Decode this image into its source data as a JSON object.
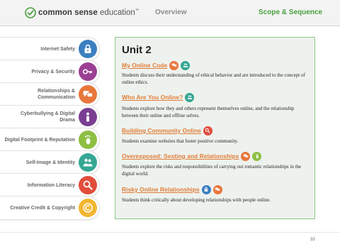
{
  "header": {
    "logo_bold": "common sense",
    "logo_light": "education",
    "logo_mark": "™",
    "nav": {
      "overview": "Overview",
      "scope": "Scope & Sequence"
    },
    "colors": {
      "active": "#4aa03f",
      "inactive": "#8c8c8c"
    }
  },
  "sidebar": {
    "items": [
      {
        "label": "Internet Safety",
        "icon": "lock-icon",
        "color": "#3b7fc0"
      },
      {
        "label": "Privacy & Security",
        "icon": "key-icon",
        "color": "#9b3f93"
      },
      {
        "label": "Relationships & Communication",
        "icon": "chat-bubbles-icon",
        "color": "#e8773c"
      },
      {
        "label": "Cyberbullying & Digital Drama",
        "icon": "person-icon",
        "color": "#7a3f92"
      },
      {
        "label": "Digital Footprint & Reputation",
        "icon": "footprint-icon",
        "color": "#8dbf42"
      },
      {
        "label": "Self-Image & Identity",
        "icon": "people-icon",
        "color": "#35a794"
      },
      {
        "label": "Information Literacy",
        "icon": "magnifier-icon",
        "color": "#e24d3b"
      },
      {
        "label": "Creative Credit & Copyright",
        "icon": "copyright-icon",
        "color": "#f2b630"
      }
    ]
  },
  "unit": {
    "title": "Unit 2",
    "lessons": [
      {
        "title": "My Online Code",
        "desc": "Students discuss their understanding of ethical behavior and are introduced to the concept of online ethics."
      },
      {
        "title": "Who Are You Online?",
        "desc": "Students explore how they and others represent themselves online, and the relationship between their online and offline selves."
      },
      {
        "title": "Building Community Online",
        "desc": "Students examine websites that foster positive community."
      },
      {
        "title": "Overexposed: Sexting and Relationships",
        "desc": "Students explore the risks and responsibilities of carrying out romantic relationships in the digital world."
      },
      {
        "title": "Risky Online Relationships",
        "desc": "Students think critically about developing relationships with people online."
      }
    ]
  },
  "footer": {
    "page": "33"
  }
}
